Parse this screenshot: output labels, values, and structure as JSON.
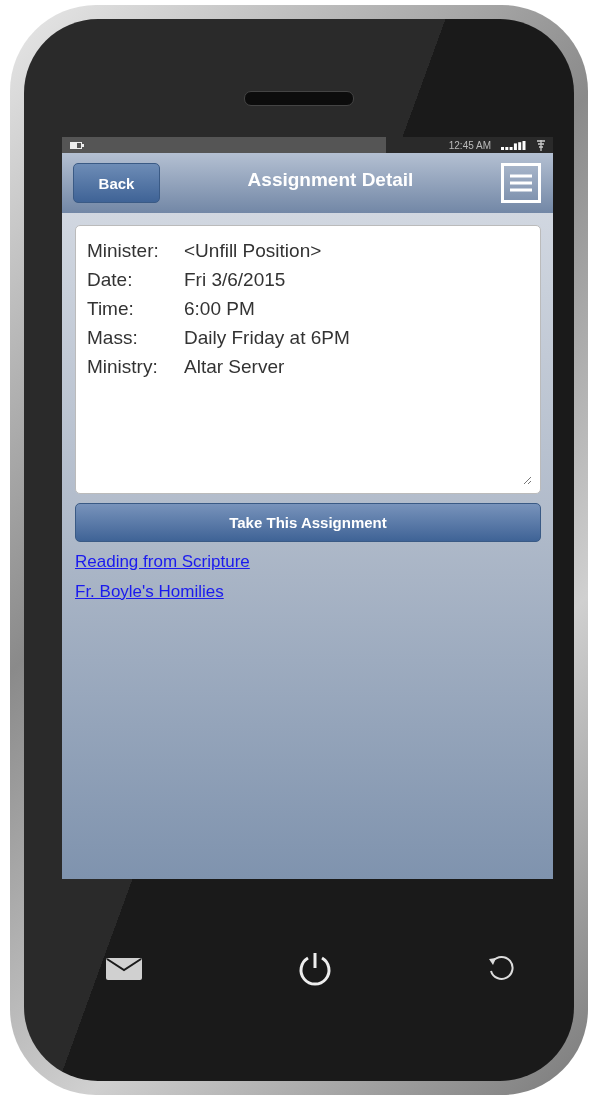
{
  "status_bar": {
    "time": "12:45 AM"
  },
  "header": {
    "back_button": "Back",
    "title": "Assignment Detail"
  },
  "details": [
    {
      "label": "Minister:",
      "value": "<Unfill Position>"
    },
    {
      "label": "Date:",
      "value": "Fri 3/6/2015"
    },
    {
      "label": "Time:",
      "value": "6:00 PM"
    },
    {
      "label": "Mass:",
      "value": "Daily Friday at 6PM"
    },
    {
      "label": "Ministry:",
      "value": "Altar Server"
    }
  ],
  "action_button": "Take This Assignment",
  "links": [
    "Reading from Scripture",
    "Fr. Boyle's Homilies"
  ]
}
